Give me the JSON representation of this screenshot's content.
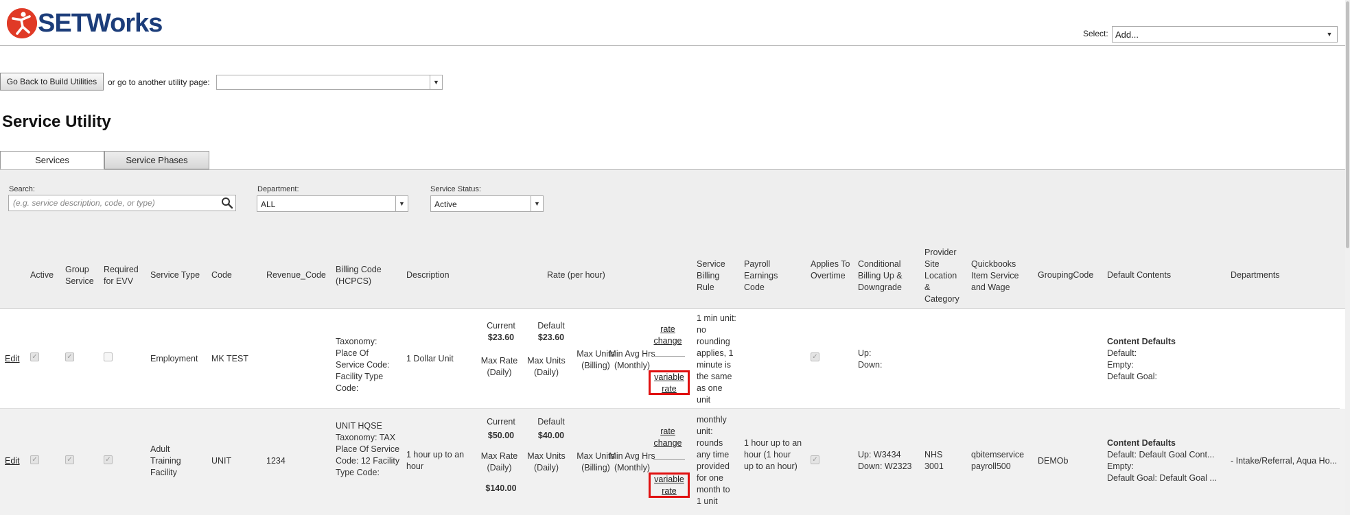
{
  "header": {
    "brand_text": "SETWorks",
    "select_label": "Select:",
    "select_value": "Add..."
  },
  "toolbar": {
    "back_button": "Go Back to Build Utilities",
    "goto_text": "or go to another utility page:",
    "goto_value": ""
  },
  "page_title": "Service Utility",
  "tabs": [
    {
      "label": "Services",
      "active": true
    },
    {
      "label": "Service Phases",
      "active": false
    }
  ],
  "filters": {
    "search_label": "Search:",
    "search_placeholder": "(e.g. service description, code, or type)",
    "department_label": "Department:",
    "department_value": "ALL",
    "status_label": "Service Status:",
    "status_value": "Active"
  },
  "columns": {
    "active": "Active",
    "group_service": "Group Service",
    "required_evv": "Required for EVV",
    "service_type": "Service Type",
    "code": "Code",
    "revenue_code": "Revenue_Code",
    "billing_code": "Billing Code (HCPCS)",
    "description": "Description",
    "rate": "Rate (per hour)",
    "billing_rule": "Service Billing Rule",
    "payroll_code": "Payroll Earnings Code",
    "overtime": "Applies To Overtime",
    "conditional": "Conditional Billing Up & Downgrade",
    "provider_site": "Provider Site Location & Category",
    "quickbooks": "Quickbooks Item Service and Wage",
    "grouping": "GroupingCode",
    "default_contents": "Default Contents",
    "departments": "Departments"
  },
  "rows": [
    {
      "edit": "Edit",
      "active": true,
      "group": true,
      "evv": false,
      "service_type": "Employment",
      "code": "MK TEST",
      "revenue_code": "",
      "billing_code": "Taxonomy: Place Of Service Code: Facility Type Code:",
      "description": "1 Dollar Unit",
      "current_label": "Current",
      "current_rate": "$23.60",
      "default_label": "Default",
      "default_rate": "$23.60",
      "max_rate_label": "Max Rate (Daily)",
      "max_rate": "",
      "max_units_daily_label": "Max Units (Daily)",
      "max_units_billing_label": "Max Units (Billing)",
      "min_avg_label": "Min Avg Hrs (Monthly)",
      "rate_change": "rate change",
      "variable_rate": "variable rate",
      "billing_rule": "1 min unit: no rounding applies, 1 minute is the same as one unit",
      "payroll_code": "",
      "overtime": true,
      "cond_up": "Up:",
      "cond_down": "Down:",
      "provider_site": "",
      "quickbooks": "",
      "grouping": "",
      "content_title": "Content Defaults",
      "content_default": "Default:",
      "content_empty": "Empty:",
      "content_goal": "Default Goal:",
      "departments": ""
    },
    {
      "edit": "Edit",
      "active": true,
      "group": true,
      "evv": true,
      "service_type": "Adult Training Facility",
      "code": "UNIT",
      "revenue_code": "1234",
      "billing_code": "UNIT HQSE Taxonomy: TAX Place Of Service Code: 12 Facility Type Code:",
      "description": "1 hour up to an hour",
      "current_label": "Current",
      "current_rate": "$50.00",
      "default_label": "Default",
      "default_rate": "$40.00",
      "max_rate_label": "Max Rate (Daily)",
      "max_rate": "$140.00",
      "max_units_daily_label": "Max Units (Daily)",
      "max_units_billing_label": "Max Units (Billing)",
      "min_avg_label": "Min Avg Hrs (Monthly)",
      "rate_change": "rate change",
      "variable_rate": "variable rate",
      "billing_rule": "monthly unit: rounds any time provided for one month to 1 unit",
      "payroll_code": "1 hour up to an hour (1 hour up to an hour)",
      "overtime": true,
      "cond_up": "Up: W3434",
      "cond_down": "Down: W2323",
      "provider_site": "NHS 3001",
      "quickbooks": "qbitemservice payroll500",
      "grouping": "DEMOb",
      "content_title": "Content Defaults",
      "content_default": "Default: Default Goal Cont...",
      "content_empty": "Empty:",
      "content_goal": "Default Goal: Default Goal ...",
      "departments": "- Intake/Referral, Aqua Ho..."
    }
  ]
}
